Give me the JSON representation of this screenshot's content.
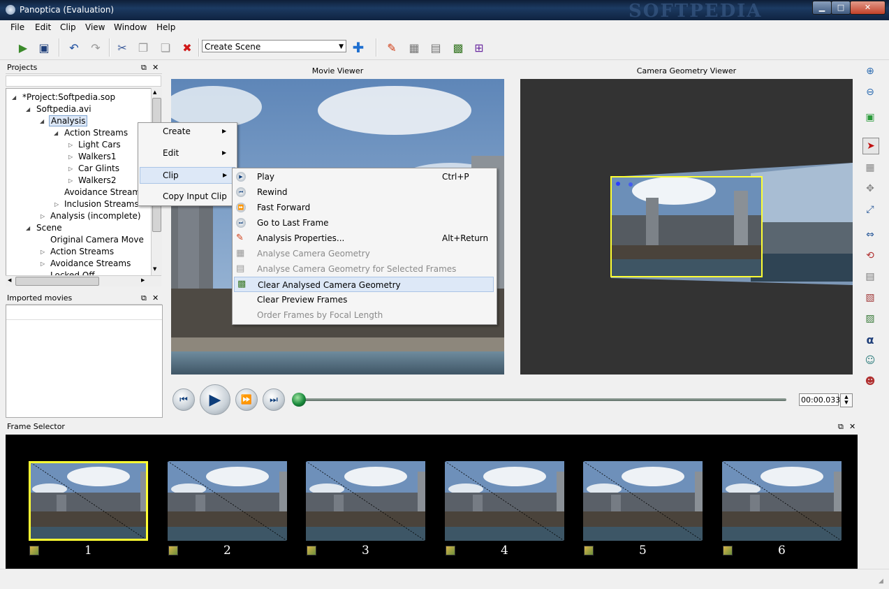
{
  "window": {
    "title": "Panoptica (Evaluation)",
    "watermark": "SOFTPEDIA",
    "min": "▁",
    "max": "□",
    "close": "✕"
  },
  "menubar": [
    "File",
    "Edit",
    "Clip",
    "View",
    "Window",
    "Help"
  ],
  "toolbar": {
    "scene_select": "Create Scene"
  },
  "projects_panel": {
    "title": "Projects",
    "tree": [
      "*Project:Softpedia.sop",
      "Softpedia.avi",
      "Analysis",
      "Action Streams",
      "Light Cars",
      "Walkers1",
      "Car Glints",
      "Walkers2",
      "Avoidance Streams",
      "Inclusion Streams",
      "Analysis (incomplete)",
      "Scene",
      "Original Camera Move",
      "Action Streams",
      "Avoidance Streams",
      "Locked Off"
    ]
  },
  "imported_panel": {
    "title": "Imported movies"
  },
  "viewers": {
    "movie": "Movie Viewer",
    "geometry": "Camera Geometry Viewer"
  },
  "player": {
    "time": "00:00.033",
    "progress": 0.0
  },
  "context_menu": {
    "items": [
      "Create",
      "Edit",
      "Clip",
      "Copy Input Clip"
    ],
    "active": "Clip"
  },
  "clip_submenu": {
    "items": [
      {
        "label": "Play",
        "shortcut": "Ctrl+P",
        "enabled": true
      },
      {
        "label": "Rewind",
        "shortcut": "",
        "enabled": true
      },
      {
        "label": "Fast Forward",
        "shortcut": "",
        "enabled": true
      },
      {
        "label": "Go to Last Frame",
        "shortcut": "",
        "enabled": true
      },
      {
        "label": "Analysis Properties...",
        "shortcut": "Alt+Return",
        "enabled": true
      },
      {
        "label": "Analyse Camera Geometry",
        "shortcut": "",
        "enabled": false
      },
      {
        "label": "Analyse Camera Geometry for Selected Frames",
        "shortcut": "",
        "enabled": false
      },
      {
        "label": "Clear Analysed Camera Geometry",
        "shortcut": "",
        "enabled": true
      },
      {
        "label": "Clear Preview Frames",
        "shortcut": "",
        "enabled": true
      },
      {
        "label": "Order Frames by Focal Length",
        "shortcut": "",
        "enabled": false
      }
    ],
    "highlighted": "Clear Analysed Camera Geometry"
  },
  "frame_selector": {
    "title": "Frame Selector",
    "frames": [
      "1",
      "2",
      "3",
      "4",
      "5",
      "6"
    ],
    "selected": "1"
  },
  "panel_controls": {
    "float": "⧉",
    "close": "✕"
  },
  "colors": {
    "accent_selection": "#ffff33",
    "titlebar": "#1c3a62",
    "menu_highlight": "#dde8f7"
  }
}
